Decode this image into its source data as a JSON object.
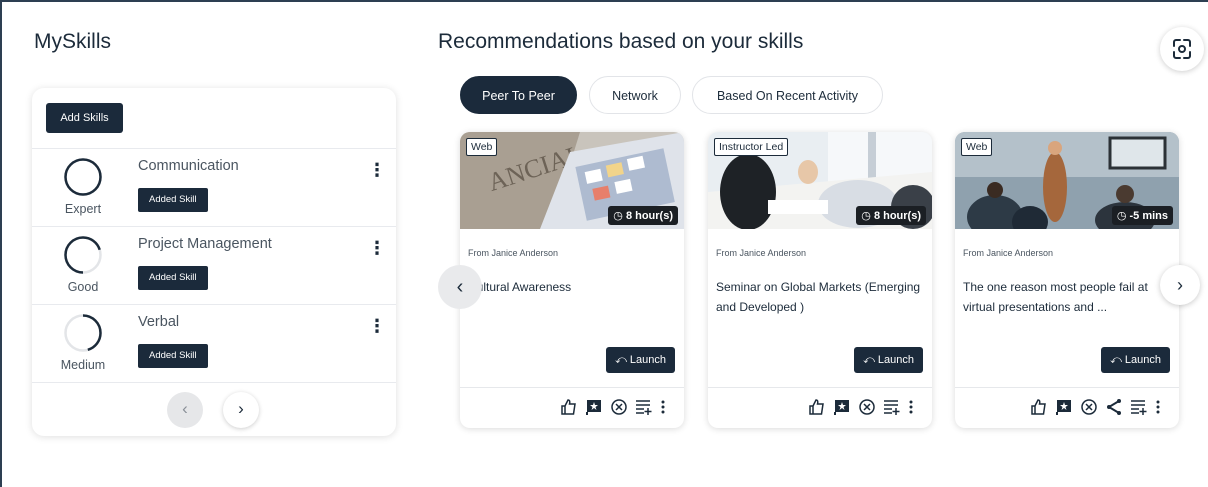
{
  "myskills": {
    "title": "MySkills",
    "add_skills_label": "Add Skills",
    "skills": [
      {
        "name": "Communication",
        "level": "Expert",
        "badge": "Added Skill",
        "progress": 1.0
      },
      {
        "name": "Project Management",
        "level": "Good",
        "badge": "Added Skill",
        "progress": 0.7
      },
      {
        "name": "Verbal",
        "level": "Medium",
        "badge": "Added Skill",
        "progress": 0.45
      }
    ],
    "pager_prev": "‹",
    "pager_next": "›"
  },
  "recommendations": {
    "title": "Recommendations based on your skills",
    "tabs": [
      {
        "label": "Peer To Peer",
        "active": true
      },
      {
        "label": "Network",
        "active": false
      },
      {
        "label": "Based On Recent Activity",
        "active": false
      }
    ],
    "cards": [
      {
        "type": "Web",
        "duration": "8 hour(s)",
        "from": "From Janice Anderson",
        "title": "Cultural Awareness",
        "launch": "Launch"
      },
      {
        "type": "Instructor Led",
        "duration": "8 hour(s)",
        "from": "From Janice Anderson",
        "title": "Seminar on Global Markets (Emerging and Developed )",
        "launch": "Launch"
      },
      {
        "type": "Web",
        "duration": "-5 mins",
        "from": "From Janice Anderson",
        "title": "The one reason most people fail at virtual presentations and ...",
        "launch": "Launch"
      }
    ],
    "carousel_prev": "‹",
    "carousel_next": "›"
  },
  "colors": {
    "primary": "#1b2a3b",
    "border": "#2d3f52",
    "muted": "#4a5560"
  },
  "icons": [
    "scan-icon",
    "like-icon",
    "flag-icon",
    "dismiss-icon",
    "add-to-playlist-icon",
    "share-icon",
    "more-vertical-icon",
    "launch-icon",
    "clock-icon"
  ]
}
